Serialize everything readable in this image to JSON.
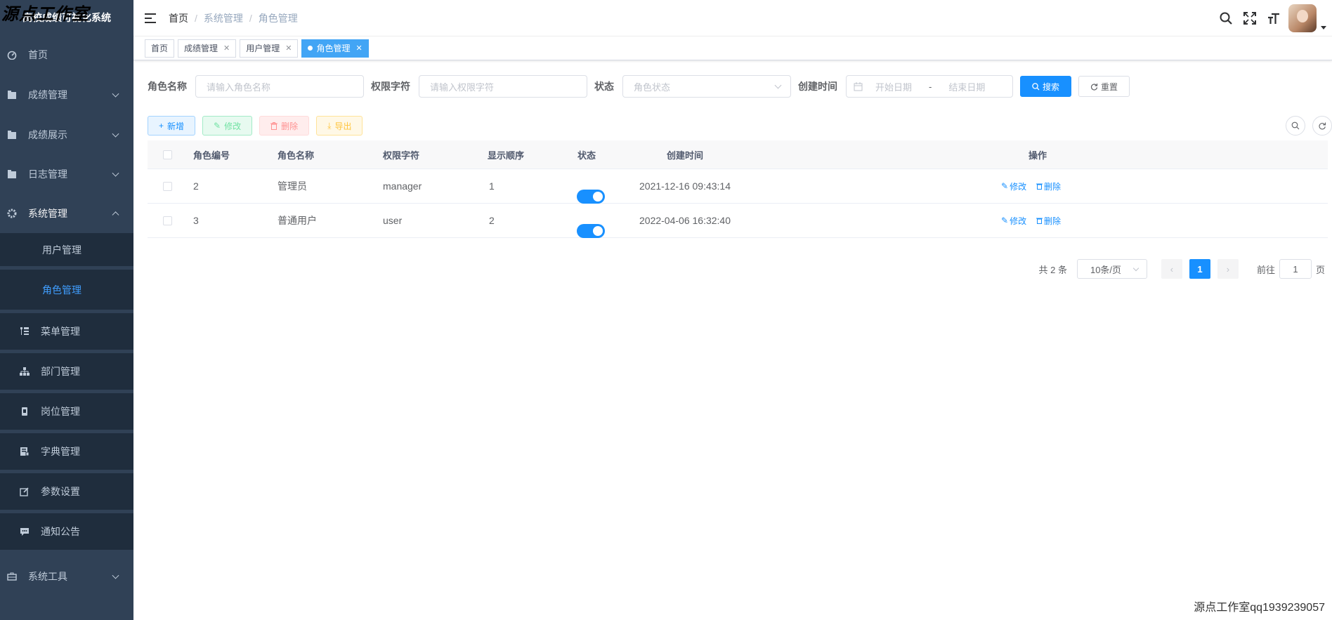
{
  "watermark": {
    "top": "源点工作室",
    "bottom": "源点工作室qq1939239057"
  },
  "sidebar": {
    "title": "高校成绩可视化系统",
    "items": [
      {
        "label": "首页",
        "icon": "dashboard-icon"
      },
      {
        "label": "成绩管理",
        "icon": "folder-icon"
      },
      {
        "label": "成绩展示",
        "icon": "folder-icon"
      },
      {
        "label": "日志管理",
        "icon": "folder-icon"
      },
      {
        "label": "系统管理",
        "icon": "gear-icon"
      },
      {
        "label": "系统工具",
        "icon": "toolbox-icon"
      }
    ],
    "sub": [
      {
        "label": "用户管理"
      },
      {
        "label": "角色管理"
      },
      {
        "label": "菜单管理",
        "icon": "tree-table-icon"
      },
      {
        "label": "部门管理",
        "icon": "org-tree-icon"
      },
      {
        "label": "岗位管理",
        "icon": "post-icon"
      },
      {
        "label": "字典管理",
        "icon": "dict-icon"
      },
      {
        "label": "参数设置",
        "icon": "edit-icon"
      },
      {
        "label": "通知公告",
        "icon": "message-icon"
      }
    ]
  },
  "breadcrumb": [
    "首页",
    "系统管理",
    "角色管理"
  ],
  "tags": [
    "首页",
    "成绩管理",
    "用户管理",
    "角色管理"
  ],
  "search": {
    "role_name_label": "角色名称",
    "role_name_placeholder": "请输入角色名称",
    "perm_label": "权限字符",
    "perm_placeholder": "请输入权限字符",
    "status_label": "状态",
    "status_placeholder": "角色状态",
    "time_label": "创建时间",
    "start_placeholder": "开始日期",
    "range_sep": "-",
    "end_placeholder": "结束日期",
    "search_btn": "搜索",
    "reset_btn": "重置"
  },
  "toolbar": {
    "add": "新增",
    "edit": "修改",
    "delete": "删除",
    "export": "导出"
  },
  "table": {
    "headers": [
      "角色编号",
      "角色名称",
      "权限字符",
      "显示顺序",
      "状态",
      "创建时间",
      "操作"
    ],
    "rows": [
      {
        "id": "2",
        "name": "管理员",
        "key": "manager",
        "sort": "1",
        "status": true,
        "time": "2021-12-16 09:43:14",
        "edit": "修改",
        "delete": "删除"
      },
      {
        "id": "3",
        "name": "普通用户",
        "key": "user",
        "sort": "2",
        "status": true,
        "time": "2022-04-06 16:32:40",
        "edit": "修改",
        "delete": "删除"
      }
    ]
  },
  "pager": {
    "total": "共 2 条",
    "size": "10条/页",
    "page": "1",
    "goto": "前往",
    "goto_value": "1",
    "page_unit": "页"
  },
  "colors": {
    "primary": "#1890ff",
    "sidebar_bg": "#304156",
    "sub_bg": "#1f2d3d"
  }
}
